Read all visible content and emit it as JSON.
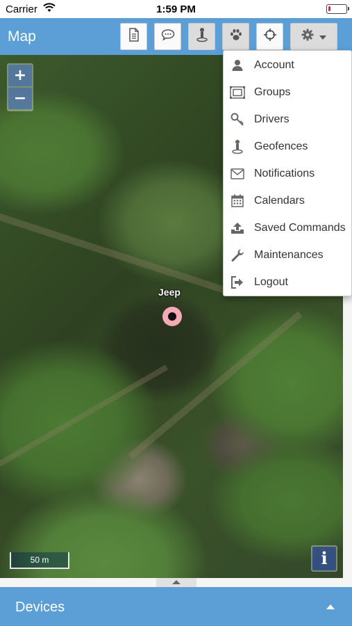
{
  "status_bar": {
    "carrier": "Carrier",
    "time": "1:59 PM"
  },
  "header": {
    "title": "Map",
    "toolbar": [
      {
        "name": "report-button",
        "icon": "document-icon"
      },
      {
        "name": "events-button",
        "icon": "chat-icon"
      },
      {
        "name": "geofence-button",
        "icon": "geofence-pin-icon"
      },
      {
        "name": "history-button",
        "icon": "paw-icon"
      },
      {
        "name": "follow-button",
        "icon": "crosshair-icon"
      },
      {
        "name": "settings-menu-button",
        "icon": "gear-icon"
      }
    ]
  },
  "map": {
    "zoom_in": "+",
    "zoom_out": "−",
    "device_label": "Jeep",
    "scale": "50 m",
    "info": "i"
  },
  "settings_menu": {
    "items": [
      {
        "label": "Account",
        "icon": "user-icon"
      },
      {
        "label": "Groups",
        "icon": "groups-icon"
      },
      {
        "label": "Drivers",
        "icon": "key-icon"
      },
      {
        "label": "Geofences",
        "icon": "geofence-pin-icon"
      },
      {
        "label": "Notifications",
        "icon": "envelope-icon"
      },
      {
        "label": "Calendars",
        "icon": "calendar-icon"
      },
      {
        "label": "Saved Commands",
        "icon": "upload-icon"
      },
      {
        "label": "Maintenances",
        "icon": "wrench-icon"
      },
      {
        "label": "Logout",
        "icon": "logout-icon"
      }
    ]
  },
  "footer": {
    "label": "Devices"
  },
  "colors": {
    "header": "#5b9fd6",
    "marker": "#f3aab4"
  }
}
